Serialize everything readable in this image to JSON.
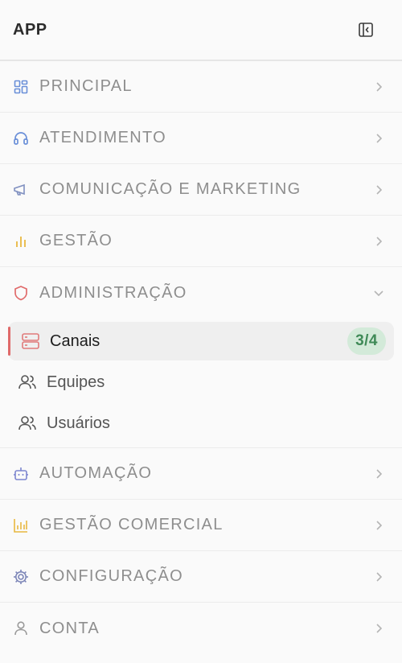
{
  "header": {
    "title": "APP",
    "collapse_icon": "sidebar-collapse-icon"
  },
  "colors": {
    "principal": "#6a8fd8",
    "atendimento": "#6a8fd8",
    "comunicacao": "#8090c0",
    "gestao": "#e8b840",
    "administracao": "#e06a6a",
    "automacao": "#7d86d0",
    "gestao_comercial": "#e8b840",
    "configuracao": "#7d86b8",
    "conta": "#999999",
    "badge_bg": "#d3ead9",
    "badge_text": "#3f8a57",
    "active_bar": "#e06a6a"
  },
  "sections": {
    "principal": {
      "label": "PRINCIPAL",
      "icon": "grid-icon"
    },
    "atendimento": {
      "label": "ATENDIMENTO",
      "icon": "headset-icon"
    },
    "comunicacao": {
      "label": "COMUNICAÇÃO E MARKETING",
      "icon": "megaphone-icon"
    },
    "gestao": {
      "label": "GESTÃO",
      "icon": "bar-chart-icon"
    },
    "administracao": {
      "label": "ADMINISTRAÇÃO",
      "icon": "shield-icon",
      "expanded": true
    },
    "automacao": {
      "label": "AUTOMAÇÃO",
      "icon": "robot-icon"
    },
    "gestao_comercial": {
      "label": "GESTÃO COMERCIAL",
      "icon": "chart-icon"
    },
    "configuracao": {
      "label": "CONFIGURAÇÃO",
      "icon": "gear-icon"
    },
    "conta": {
      "label": "CONTA",
      "icon": "user-icon"
    }
  },
  "admin_items": {
    "canais": {
      "label": "Canais",
      "badge": "3/4",
      "icon": "server-icon",
      "active": true
    },
    "equipes": {
      "label": "Equipes",
      "icon": "users-icon"
    },
    "usuarios": {
      "label": "Usuários",
      "icon": "users-icon"
    }
  }
}
